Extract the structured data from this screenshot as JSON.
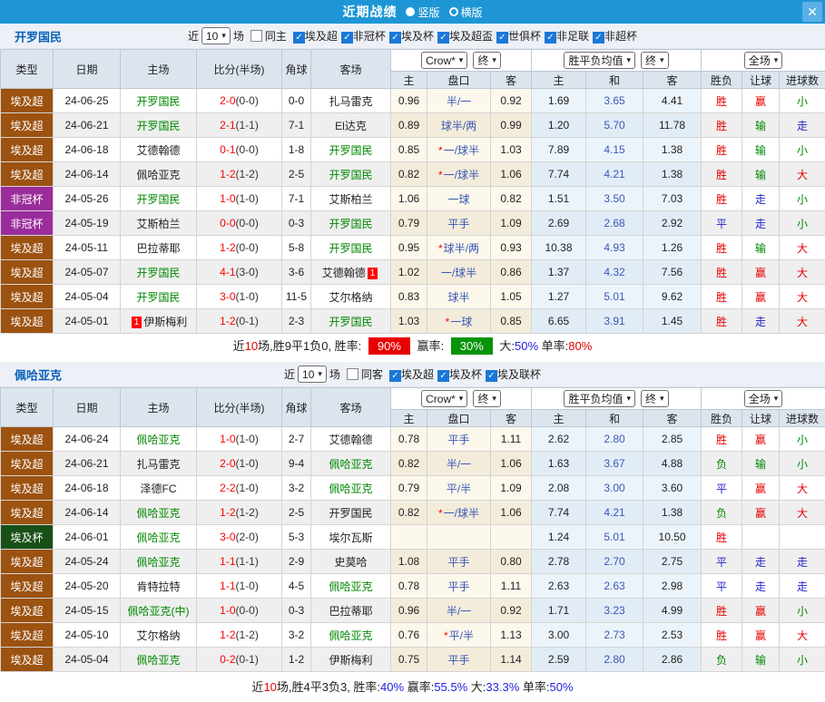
{
  "icons": {
    "check": "✓",
    "caret": "▾",
    "close": "✕",
    "star": "*"
  },
  "colors": {
    "topbar": "#1e96d5",
    "close_bg": "#5bb0e8",
    "section_title": "#0a62b8",
    "team_highlight": "#008800",
    "score": "#ff0000",
    "handicap_blue": "#3a57b5",
    "league": {
      "埃及超": "#9c5210",
      "非冠杯": "#9b2c9b",
      "埃及杯": "#185018"
    },
    "result": {
      "胜": "#e60000",
      "赢": "#e60000",
      "大": "#e60000",
      "平": "#2323cc",
      "走": "#2323cc",
      "负": "#008800",
      "输": "#008800",
      "小": "#008800"
    },
    "badge": {
      "red": "#e80000",
      "green": "#089408"
    },
    "summary": {
      "red": "#e60000",
      "blue": "#2222dd"
    }
  },
  "titlebar": {
    "title": "近期战绩",
    "vertical_label": "竖版",
    "horizontal_label": "横版"
  },
  "columns": {
    "base": [
      "类型",
      "日期",
      "主场",
      "比分(半场)",
      "角球",
      "客场"
    ],
    "asian_select": "Crow*",
    "asian_final": "终",
    "europe_select": "胜平负均值",
    "europe_final": "终",
    "scope_select": "全场",
    "asian_sub": [
      "主",
      "盘口",
      "客"
    ],
    "europe_sub": [
      "主",
      "和",
      "客"
    ],
    "result_sub": [
      "胜负",
      "让球",
      "进球数"
    ]
  },
  "sections": [
    {
      "team": "开罗国民",
      "filter": {
        "near": "近",
        "count": "10",
        "games": "场",
        "same": "同主",
        "leagues": [
          "埃及超",
          "非冠杯",
          "埃及杯",
          "埃及超盃",
          "世俱杯",
          "非足联",
          "非超杯"
        ]
      },
      "rows": [
        {
          "league": "埃及超",
          "date": "24-06-25",
          "home": "开罗国民",
          "home_team": true,
          "score": "2-0",
          "half": "(0-0)",
          "corners": "0-0",
          "away": "扎马雷克",
          "away_team": false,
          "ah_home": "0.96",
          "handicap": "半/一",
          "star": false,
          "ah_away": "0.92",
          "eu_home": "1.69",
          "eu_draw": "3.65",
          "eu_away": "4.41",
          "result": "胜",
          "handicap_result": "赢",
          "goals_result": "小"
        },
        {
          "league": "埃及超",
          "date": "24-06-21",
          "home": "开罗国民",
          "home_team": true,
          "score": "2-1",
          "half": "(1-1)",
          "corners": "7-1",
          "away": "El达克",
          "away_team": false,
          "ah_home": "0.89",
          "handicap": "球半/两",
          "star": false,
          "ah_away": "0.99",
          "eu_home": "1.20",
          "eu_draw": "5.70",
          "eu_away": "11.78",
          "result": "胜",
          "handicap_result": "输",
          "goals_result": "走"
        },
        {
          "league": "埃及超",
          "date": "24-06-18",
          "home": "艾德翰德",
          "home_team": false,
          "score": "0-1",
          "half": "(0-0)",
          "corners": "1-8",
          "away": "开罗国民",
          "away_team": true,
          "ah_home": "0.85",
          "handicap": "一/球半",
          "star": true,
          "ah_away": "1.03",
          "eu_home": "7.89",
          "eu_draw": "4.15",
          "eu_away": "1.38",
          "result": "胜",
          "handicap_result": "输",
          "goals_result": "小"
        },
        {
          "league": "埃及超",
          "date": "24-06-14",
          "home": "佩哈亚克",
          "home_team": false,
          "score": "1-2",
          "half": "(1-2)",
          "corners": "2-5",
          "away": "开罗国民",
          "away_team": true,
          "ah_home": "0.82",
          "handicap": "一/球半",
          "star": true,
          "ah_away": "1.06",
          "eu_home": "7.74",
          "eu_draw": "4.21",
          "eu_away": "1.38",
          "result": "胜",
          "handicap_result": "输",
          "goals_result": "大"
        },
        {
          "league": "非冠杯",
          "date": "24-05-26",
          "home": "开罗国民",
          "home_team": true,
          "score": "1-0",
          "half": "(1-0)",
          "corners": "7-1",
          "away": "艾斯柏兰",
          "away_team": false,
          "ah_home": "1.06",
          "handicap": "一球",
          "star": false,
          "ah_away": "0.82",
          "eu_home": "1.51",
          "eu_draw": "3.50",
          "eu_away": "7.03",
          "result": "胜",
          "handicap_result": "走",
          "goals_result": "小"
        },
        {
          "league": "非冠杯",
          "date": "24-05-19",
          "home": "艾斯柏兰",
          "home_team": false,
          "score": "0-0",
          "half": "(0-0)",
          "corners": "0-3",
          "away": "开罗国民",
          "away_team": true,
          "ah_home": "0.79",
          "handicap": "平手",
          "star": false,
          "ah_away": "1.09",
          "eu_home": "2.69",
          "eu_draw": "2.68",
          "eu_away": "2.92",
          "result": "平",
          "handicap_result": "走",
          "goals_result": "小"
        },
        {
          "league": "埃及超",
          "date": "24-05-11",
          "home": "巴拉蒂耶",
          "home_team": false,
          "score": "1-2",
          "half": "(0-0)",
          "corners": "5-8",
          "away": "开罗国民",
          "away_team": true,
          "ah_home": "0.95",
          "handicap": "球半/两",
          "star": true,
          "ah_away": "0.93",
          "eu_home": "10.38",
          "eu_draw": "4.93",
          "eu_away": "1.26",
          "result": "胜",
          "handicap_result": "输",
          "goals_result": "大"
        },
        {
          "league": "埃及超",
          "date": "24-05-07",
          "home": "开罗国民",
          "home_team": true,
          "score": "4-1",
          "half": "(3-0)",
          "corners": "3-6",
          "away": "艾德翰德",
          "away_team": false,
          "away_card": "1",
          "ah_home": "1.02",
          "handicap": "一/球半",
          "star": false,
          "ah_away": "0.86",
          "eu_home": "1.37",
          "eu_draw": "4.32",
          "eu_away": "7.56",
          "result": "胜",
          "handicap_result": "赢",
          "goals_result": "大"
        },
        {
          "league": "埃及超",
          "date": "24-05-04",
          "home": "开罗国民",
          "home_team": true,
          "score": "3-0",
          "half": "(1-0)",
          "corners": "11-5",
          "away": "艾尔格纳",
          "away_team": false,
          "ah_home": "0.83",
          "handicap": "球半",
          "star": false,
          "ah_away": "1.05",
          "eu_home": "1.27",
          "eu_draw": "5.01",
          "eu_away": "9.62",
          "result": "胜",
          "handicap_result": "赢",
          "goals_result": "大"
        },
        {
          "league": "埃及超",
          "date": "24-05-01",
          "home": "伊斯梅利",
          "home_team": false,
          "home_card": "1",
          "score": "1-2",
          "half": "(0-1)",
          "corners": "2-3",
          "away": "开罗国民",
          "away_team": true,
          "ah_home": "1.03",
          "handicap": "一球",
          "star": true,
          "ah_away": "0.85",
          "eu_home": "6.65",
          "eu_draw": "3.91",
          "eu_away": "1.45",
          "result": "胜",
          "handicap_result": "走",
          "goals_result": "大"
        }
      ],
      "summary": {
        "parts": [
          {
            "t": "近"
          },
          {
            "t": "10",
            "c": "red"
          },
          {
            "t": "场,胜9平1负0, 胜率: "
          },
          {
            "t": "90%",
            "badge": "red"
          },
          {
            "t": " 赢率: "
          },
          {
            "t": "30%",
            "badge": "green"
          },
          {
            "t": " 大:"
          },
          {
            "t": "50%",
            "c": "blue"
          },
          {
            "t": " 单率:"
          },
          {
            "t": "80%",
            "c": "red"
          }
        ]
      }
    },
    {
      "team": "佩哈亚克",
      "filter": {
        "near": "近",
        "count": "10",
        "games": "场",
        "same": "同客",
        "leagues": [
          "埃及超",
          "埃及杯",
          "埃及联杯"
        ]
      },
      "rows": [
        {
          "league": "埃及超",
          "date": "24-06-24",
          "home": "佩哈亚克",
          "home_team": true,
          "score": "1-0",
          "half": "(1-0)",
          "corners": "2-7",
          "away": "艾德翰德",
          "away_team": false,
          "ah_home": "0.78",
          "handicap": "平手",
          "star": false,
          "ah_away": "1.11",
          "eu_home": "2.62",
          "eu_draw": "2.80",
          "eu_away": "2.85",
          "result": "胜",
          "handicap_result": "赢",
          "goals_result": "小"
        },
        {
          "league": "埃及超",
          "date": "24-06-21",
          "home": "扎马雷克",
          "home_team": false,
          "score": "2-0",
          "half": "(1-0)",
          "corners": "9-4",
          "away": "佩哈亚克",
          "away_team": true,
          "ah_home": "0.82",
          "handicap": "半/一",
          "star": false,
          "ah_away": "1.06",
          "eu_home": "1.63",
          "eu_draw": "3.67",
          "eu_away": "4.88",
          "result": "负",
          "handicap_result": "输",
          "goals_result": "小"
        },
        {
          "league": "埃及超",
          "date": "24-06-18",
          "home": "泽德FC",
          "home_team": false,
          "score": "2-2",
          "half": "(1-0)",
          "corners": "3-2",
          "away": "佩哈亚克",
          "away_team": true,
          "ah_home": "0.79",
          "handicap": "平/半",
          "star": false,
          "ah_away": "1.09",
          "eu_home": "2.08",
          "eu_draw": "3.00",
          "eu_away": "3.60",
          "result": "平",
          "handicap_result": "赢",
          "goals_result": "大"
        },
        {
          "league": "埃及超",
          "date": "24-06-14",
          "home": "佩哈亚克",
          "home_team": true,
          "score": "1-2",
          "half": "(1-2)",
          "corners": "2-5",
          "away": "开罗国民",
          "away_team": false,
          "ah_home": "0.82",
          "handicap": "一/球半",
          "star": true,
          "ah_away": "1.06",
          "eu_home": "7.74",
          "eu_draw": "4.21",
          "eu_away": "1.38",
          "result": "负",
          "handicap_result": "赢",
          "goals_result": "大"
        },
        {
          "league": "埃及杯",
          "date": "24-06-01",
          "home": "佩哈亚克",
          "home_team": true,
          "score": "3-0",
          "half": "(2-0)",
          "corners": "5-3",
          "away": "埃尔瓦斯",
          "away_team": false,
          "ah_home": "",
          "handicap": "",
          "star": false,
          "ah_away": "",
          "eu_home": "1.24",
          "eu_draw": "5.01",
          "eu_away": "10.50",
          "result": "胜",
          "handicap_result": "",
          "goals_result": ""
        },
        {
          "league": "埃及超",
          "date": "24-05-24",
          "home": "佩哈亚克",
          "home_team": true,
          "score": "1-1",
          "half": "(1-1)",
          "corners": "2-9",
          "away": "史莫哈",
          "away_team": false,
          "ah_home": "1.08",
          "handicap": "平手",
          "star": false,
          "ah_away": "0.80",
          "eu_home": "2.78",
          "eu_draw": "2.70",
          "eu_away": "2.75",
          "result": "平",
          "handicap_result": "走",
          "goals_result": "走"
        },
        {
          "league": "埃及超",
          "date": "24-05-20",
          "home": "肯特拉特",
          "home_team": false,
          "score": "1-1",
          "half": "(1-0)",
          "corners": "4-5",
          "away": "佩哈亚克",
          "away_team": true,
          "ah_home": "0.78",
          "handicap": "平手",
          "star": false,
          "ah_away": "1.11",
          "eu_home": "2.63",
          "eu_draw": "2.63",
          "eu_away": "2.98",
          "result": "平",
          "handicap_result": "走",
          "goals_result": "走"
        },
        {
          "league": "埃及超",
          "date": "24-05-15",
          "home": "佩哈亚克(中)",
          "home_team": true,
          "score": "1-0",
          "half": "(0-0)",
          "corners": "0-3",
          "away": "巴拉蒂耶",
          "away_team": false,
          "ah_home": "0.96",
          "handicap": "半/一",
          "star": false,
          "ah_away": "0.92",
          "eu_home": "1.71",
          "eu_draw": "3.23",
          "eu_away": "4.99",
          "result": "胜",
          "handicap_result": "赢",
          "goals_result": "小"
        },
        {
          "league": "埃及超",
          "date": "24-05-10",
          "home": "艾尔格纳",
          "home_team": false,
          "score": "1-2",
          "half": "(1-2)",
          "corners": "3-2",
          "away": "佩哈亚克",
          "away_team": true,
          "ah_home": "0.76",
          "handicap": "平/半",
          "star": true,
          "ah_away": "1.13",
          "eu_home": "3.00",
          "eu_draw": "2.73",
          "eu_away": "2.53",
          "result": "胜",
          "handicap_result": "赢",
          "goals_result": "大"
        },
        {
          "league": "埃及超",
          "date": "24-05-04",
          "home": "佩哈亚克",
          "home_team": true,
          "score": "0-2",
          "half": "(0-1)",
          "corners": "1-2",
          "away": "伊斯梅利",
          "away_team": false,
          "ah_home": "0.75",
          "handicap": "平手",
          "star": false,
          "ah_away": "1.14",
          "eu_home": "2.59",
          "eu_draw": "2.80",
          "eu_away": "2.86",
          "result": "负",
          "handicap_result": "输",
          "goals_result": "小"
        }
      ],
      "summary": {
        "parts": [
          {
            "t": "近"
          },
          {
            "t": "10",
            "c": "red"
          },
          {
            "t": "场,胜4平3负3, 胜率:"
          },
          {
            "t": "40%",
            "c": "blue"
          },
          {
            "t": " 赢率:"
          },
          {
            "t": "55.5%",
            "c": "blue"
          },
          {
            "t": " 大:"
          },
          {
            "t": "33.3%",
            "c": "blue"
          },
          {
            "t": " 单率:"
          },
          {
            "t": "50%",
            "c": "blue"
          }
        ]
      }
    }
  ]
}
